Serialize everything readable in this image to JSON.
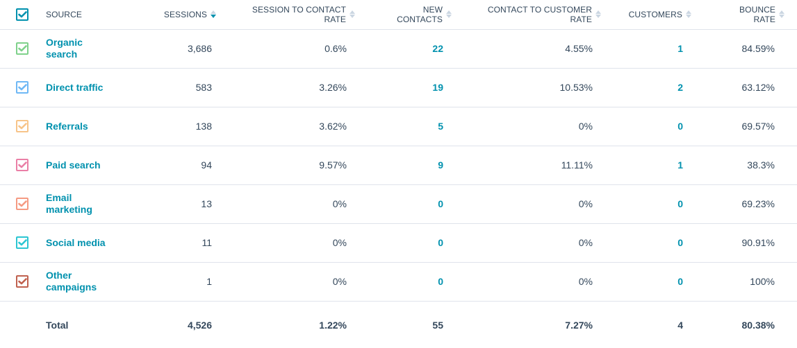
{
  "header": {
    "select_all_color": "#0091ae",
    "columns": [
      {
        "label_line1": "SOURCE",
        "label_line2": "",
        "sortable": false
      },
      {
        "label_line1": "SESSIONS",
        "label_line2": "",
        "sortable": true,
        "sort_state": "descending"
      },
      {
        "label_line1": "SESSION TO CONTACT",
        "label_line2": "RATE",
        "sortable": true,
        "sort_state": "none"
      },
      {
        "label_line1": "NEW",
        "label_line2": "CONTACTS",
        "sortable": true,
        "sort_state": "none"
      },
      {
        "label_line1": "CONTACT TO CUSTOMER",
        "label_line2": "RATE",
        "sortable": true,
        "sort_state": "none"
      },
      {
        "label_line1": "CUSTOMERS",
        "label_line2": "",
        "sortable": true,
        "sort_state": "none"
      },
      {
        "label_line1": "BOUNCE",
        "label_line2": "RATE",
        "sortable": true,
        "sort_state": "none"
      }
    ]
  },
  "rows": [
    {
      "source_line1": "Organic",
      "source_line2": "search",
      "color": "#7fd18b",
      "sessions": "3,686",
      "session_to_contact_rate": "0.6%",
      "new_contacts": "22",
      "contact_to_customer_rate": "4.55%",
      "customers": "1",
      "bounce_rate": "84.59%"
    },
    {
      "source_line1": "Direct traffic",
      "source_line2": "",
      "color": "#6fb8f5",
      "sessions": "583",
      "session_to_contact_rate": "3.26%",
      "new_contacts": "19",
      "contact_to_customer_rate": "10.53%",
      "customers": "2",
      "bounce_rate": "63.12%"
    },
    {
      "source_line1": "Referrals",
      "source_line2": "",
      "color": "#f7c489",
      "sessions": "138",
      "session_to_contact_rate": "3.62%",
      "new_contacts": "5",
      "contact_to_customer_rate": "0%",
      "customers": "0",
      "bounce_rate": "69.57%"
    },
    {
      "source_line1": "Paid search",
      "source_line2": "",
      "color": "#ea7fa6",
      "sessions": "94",
      "session_to_contact_rate": "9.57%",
      "new_contacts": "9",
      "contact_to_customer_rate": "11.11%",
      "customers": "1",
      "bounce_rate": "38.3%"
    },
    {
      "source_line1": "Email",
      "source_line2": "marketing",
      "color": "#f59a82",
      "sessions": "13",
      "session_to_contact_rate": "0%",
      "new_contacts": "0",
      "contact_to_customer_rate": "0%",
      "customers": "0",
      "bounce_rate": "69.23%"
    },
    {
      "source_line1": "Social media",
      "source_line2": "",
      "color": "#2cc6d2",
      "sessions": "11",
      "session_to_contact_rate": "0%",
      "new_contacts": "0",
      "contact_to_customer_rate": "0%",
      "customers": "0",
      "bounce_rate": "90.91%"
    },
    {
      "source_line1": "Other",
      "source_line2": "campaigns",
      "color": "#c0614f",
      "sessions": "1",
      "session_to_contact_rate": "0%",
      "new_contacts": "0",
      "contact_to_customer_rate": "0%",
      "customers": "0",
      "bounce_rate": "100%"
    }
  ],
  "total": {
    "label": "Total",
    "sessions": "4,526",
    "session_to_contact_rate": "1.22%",
    "new_contacts": "55",
    "contact_to_customer_rate": "7.27%",
    "customers": "4",
    "bounce_rate": "80.38%"
  },
  "icons": {
    "checkbox": "check-icon",
    "sort": "sort-arrows-icon"
  }
}
